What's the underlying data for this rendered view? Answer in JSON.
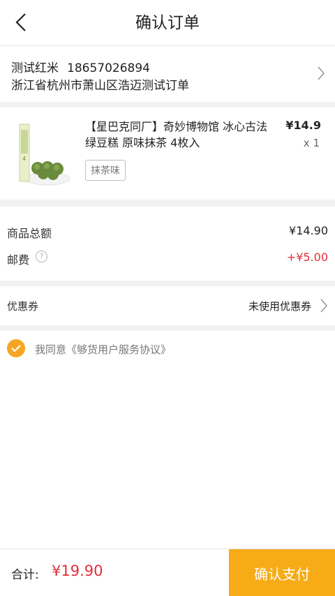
{
  "header": {
    "title": "确认订单"
  },
  "address": {
    "name": "测试红米",
    "phone": "18657026894",
    "detail": "浙江省杭州市萧山区浩迈测试订单"
  },
  "product": {
    "title": "【星巴克同厂】奇妙博物馆 冰心古法绿豆糕 原味抹茶 4枚入",
    "price": "¥14.9",
    "quantity": "x 1",
    "variant": "抹茶味"
  },
  "summary": {
    "subtotal_label": "商品总额",
    "subtotal_value": "¥14.90",
    "shipping_label": "邮费",
    "shipping_help": "?",
    "shipping_value": "+¥5.00"
  },
  "coupon": {
    "label": "优惠券",
    "value": "未使用优惠券"
  },
  "agreement": {
    "text": "我同意《够货用户服务协议》",
    "checked": true
  },
  "footer": {
    "total_label": "合计:",
    "total_value": "¥19.90",
    "pay_label": "确认支付"
  },
  "colors": {
    "accent": "#f7ab16",
    "price_red": "#e0303a",
    "background": "#f2f2f2"
  }
}
